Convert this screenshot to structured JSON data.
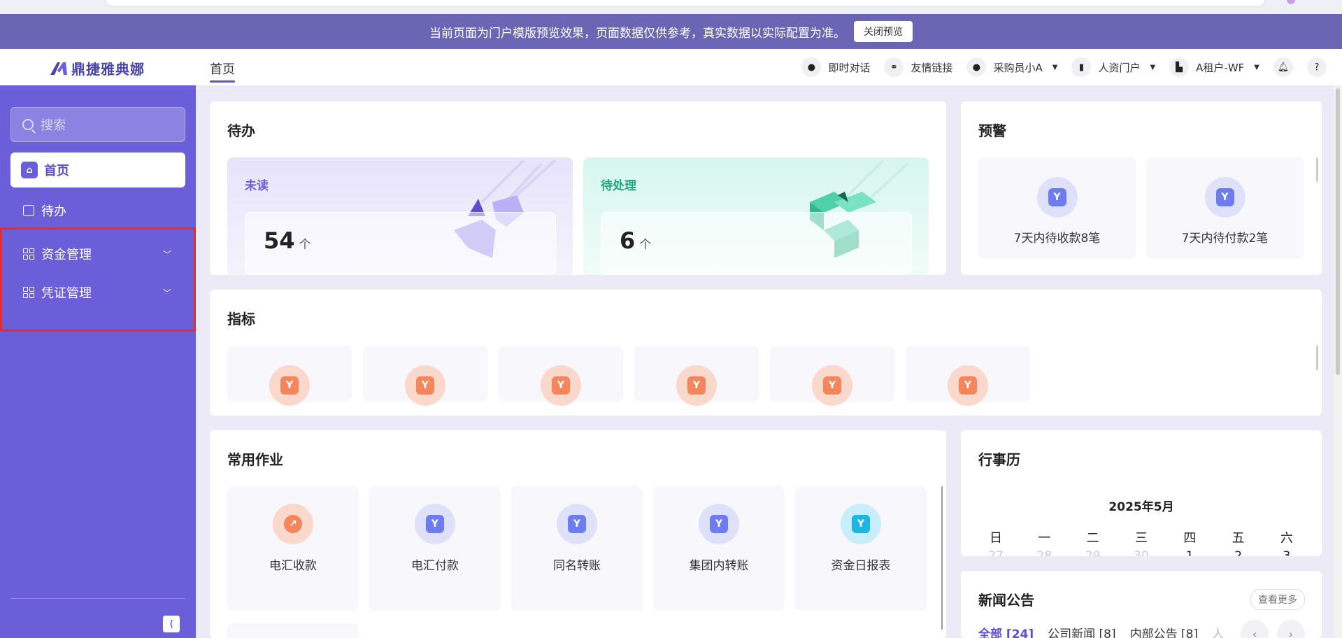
{
  "banner": {
    "message": "当前页面为门户模版预览效果，页面数据仅供参考，真实数据以实际配置为准。",
    "close_label": "关闭预览"
  },
  "header": {
    "logo_text": "鼎捷雅典娜",
    "home_tab": "首页",
    "chat": "即时对话",
    "links": "友情链接",
    "user": "采购员小A",
    "portal": "人资门户",
    "tenant": "A租户-WF"
  },
  "sidebar": {
    "search_placeholder": "搜索",
    "items": [
      {
        "label": "首页"
      },
      {
        "label": "待办"
      },
      {
        "label": "资金管理"
      },
      {
        "label": "凭证管理"
      }
    ]
  },
  "todo": {
    "title": "待办",
    "unread_label": "未读",
    "unread_count": "54",
    "unread_unit": "个",
    "pending_label": "待处理",
    "pending_count": "6",
    "pending_unit": "个"
  },
  "warning": {
    "title": "预警",
    "items": [
      {
        "label": "7天内待收款8笔"
      },
      {
        "label": "7天内待付款2笔"
      }
    ]
  },
  "metrics": {
    "title": "指标"
  },
  "jobs": {
    "title": "常用作业",
    "items": [
      {
        "label": "电汇收款"
      },
      {
        "label": "电汇付款"
      },
      {
        "label": "同名转账"
      },
      {
        "label": "集团内转账"
      },
      {
        "label": "资金日报表"
      }
    ]
  },
  "calendar": {
    "title": "行事历",
    "month": "2025年5月",
    "weekdays": [
      "日",
      "一",
      "二",
      "三",
      "四",
      "五",
      "六"
    ],
    "first_row": [
      "27",
      "28",
      "29",
      "30",
      "1",
      "2",
      "3"
    ]
  },
  "news": {
    "title": "新闻公告",
    "more": "查看更多",
    "tabs": [
      "全部 [24]",
      "公司新闻 [8]",
      "内部公告 [8]",
      "人"
    ]
  },
  "colors": {
    "accent": "#6b5fd9",
    "banner": "#6b66b3",
    "highlight": "#e52d2d"
  }
}
